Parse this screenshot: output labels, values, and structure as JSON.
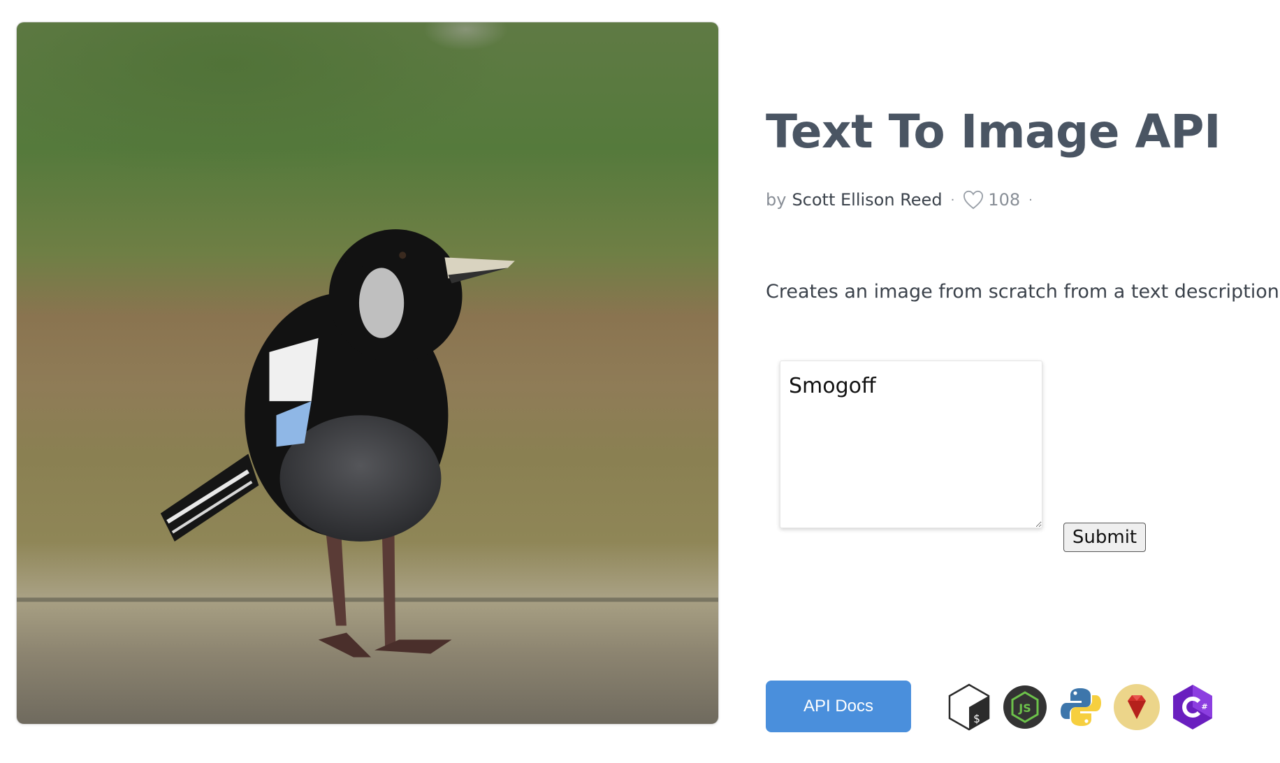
{
  "app": {
    "title": "Text To Image API",
    "author_prefix": "by",
    "author": "Scott Ellison Reed",
    "likes": "108",
    "separator": "·",
    "description": "Creates an image from scratch from a text description."
  },
  "prompt": {
    "value": "Smogoff",
    "placeholder": ""
  },
  "buttons": {
    "submit_label": "Submit",
    "api_docs_label": "API Docs"
  },
  "preview": {
    "alt": "magpie bird standing on gravel"
  },
  "languages": [
    {
      "name": "bash",
      "icon": "bash-icon"
    },
    {
      "name": "nodejs",
      "icon": "nodejs-icon"
    },
    {
      "name": "python",
      "icon": "python-icon"
    },
    {
      "name": "ruby",
      "icon": "ruby-icon"
    },
    {
      "name": "csharp",
      "icon": "csharp-icon"
    }
  ],
  "colors": {
    "title": "#4a5563",
    "accent": "#4a8fdc",
    "muted": "#888e96"
  }
}
